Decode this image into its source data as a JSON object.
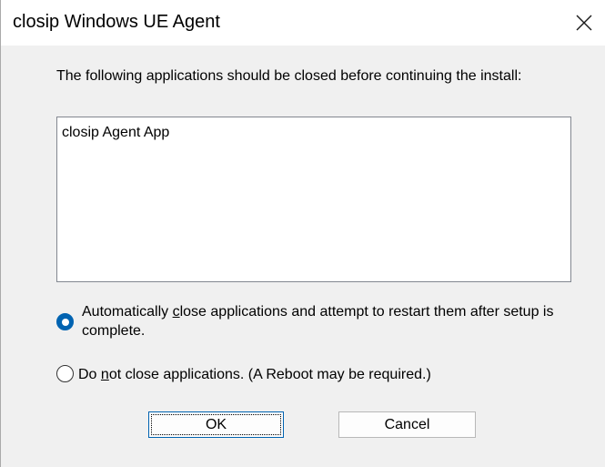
{
  "window": {
    "title": "closip Windows UE Agent",
    "close_icon": "close-x-icon"
  },
  "dialog": {
    "message": "The following applications should be closed before continuing the install:",
    "applications": [
      "closip Agent App"
    ],
    "options": [
      {
        "label_pre": "Automatically ",
        "label_accel": "c",
        "label_post": "lose applications and attempt to restart them after setup is complete.",
        "selected": true
      },
      {
        "label_pre": "Do ",
        "label_accel": "n",
        "label_post": "ot close applications. (A Reboot may be required.)",
        "selected": false
      }
    ],
    "ok_label": "OK",
    "cancel_label": "Cancel"
  },
  "colors": {
    "accent": "#0063b1",
    "dialog_background": "#f0f0f0",
    "title_background": "#ffffff"
  }
}
